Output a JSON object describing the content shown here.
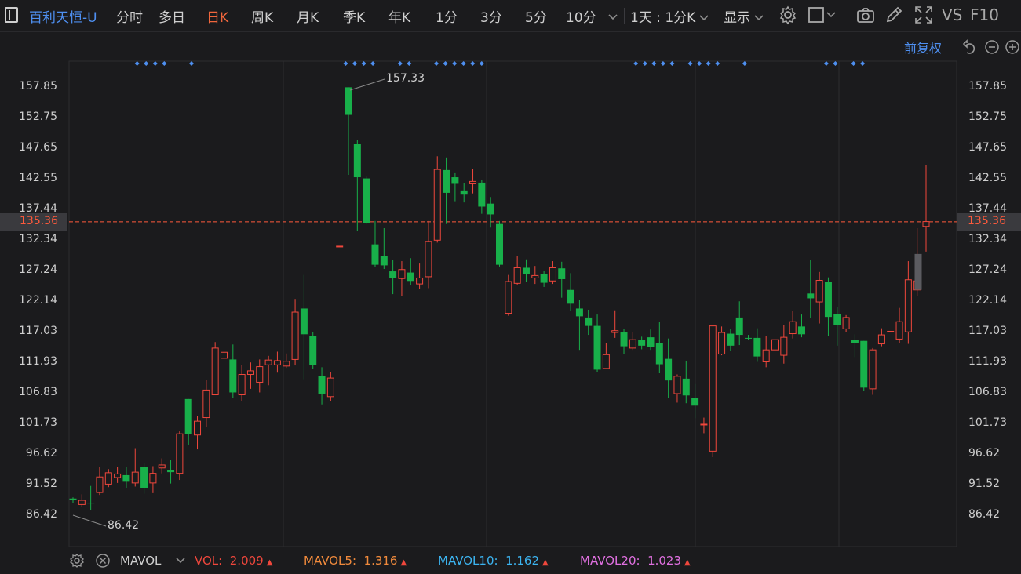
{
  "toolbar": {
    "title": "百利天恒-U",
    "periods": [
      "分时",
      "多日",
      "日K",
      "周K",
      "月K",
      "季K",
      "年K",
      "1分",
      "3分",
      "5分",
      "10分"
    ],
    "active_period": "日K",
    "combo": "1天 : 1分K",
    "display": "显示",
    "vs": "VS",
    "f10": "F10"
  },
  "header_right": {
    "adjust": "前复权"
  },
  "axis": {
    "ticks": [
      "157.85",
      "152.75",
      "147.65",
      "142.55",
      "137.44",
      "132.34",
      "127.24",
      "122.14",
      "117.03",
      "111.93",
      "106.83",
      "101.73",
      "96.62",
      "91.52",
      "86.42"
    ],
    "current_price": "135.36",
    "max_label": "157.33",
    "min_label": "86.42"
  },
  "colors": {
    "up": "#f0473c",
    "down": "#18b04a",
    "dot": "#4e8ff0",
    "bg": "#1b1b1d",
    "current": "#ff5a3c"
  },
  "chart_data": {
    "type": "candlestick",
    "ylim": [
      82,
      160
    ],
    "current_price": 135.36,
    "max": 157.33,
    "min": 86.42,
    "candles": [
      [
        89.2,
        89.0,
        88.5,
        89.4
      ],
      [
        88.2,
        88.9,
        87.8,
        89.9
      ],
      [
        88.5,
        88.4,
        87.3,
        91.3
      ],
      [
        90.2,
        92.8,
        89.8,
        94.5
      ],
      [
        91.6,
        93.5,
        91.1,
        94.1
      ],
      [
        92.7,
        93.3,
        91.8,
        94.5
      ],
      [
        93.1,
        92.0,
        91.0,
        94.4
      ],
      [
        91.8,
        93.6,
        91.2,
        97.6
      ],
      [
        94.5,
        91.0,
        90.0,
        95.1
      ],
      [
        91.8,
        93.4,
        90.1,
        94.6
      ],
      [
        94.3,
        94.8,
        93.4,
        95.9
      ],
      [
        94.0,
        93.6,
        91.7,
        95.7
      ],
      [
        93.4,
        100.0,
        92.3,
        100.4
      ],
      [
        105.8,
        100.0,
        98.2,
        105.8
      ],
      [
        99.8,
        102.1,
        97.4,
        103.0
      ],
      [
        102.7,
        107.3,
        101.2,
        109.0
      ],
      [
        106.5,
        114.3,
        106.5,
        115.3
      ],
      [
        112.6,
        113.6,
        109.9,
        114.3
      ],
      [
        112.4,
        106.9,
        106.0,
        114.9
      ],
      [
        106.5,
        109.9,
        105.5,
        111.5
      ],
      [
        109.9,
        110.5,
        107.5,
        111.9
      ],
      [
        108.6,
        111.2,
        106.9,
        112.4
      ],
      [
        111.5,
        112.3,
        108.1,
        113.0
      ],
      [
        111.5,
        112.2,
        110.2,
        113.7
      ],
      [
        111.3,
        112.1,
        111.0,
        113.4
      ],
      [
        112.4,
        120.3,
        111.4,
        122.5
      ],
      [
        120.9,
        116.6,
        109.1,
        126.5
      ],
      [
        116.3,
        111.5,
        110.8,
        117.0
      ],
      [
        109.6,
        106.7,
        104.9,
        111.1
      ],
      [
        106.2,
        109.3,
        105.5,
        110.3
      ],
      [
        131.3,
        131.3,
        131.3,
        131.3
      ],
      [
        157.8,
        153.2,
        143.2,
        157.8
      ],
      [
        148.3,
        142.8,
        133.9,
        149.0
      ],
      [
        142.6,
        135.2,
        135.0,
        142.9
      ],
      [
        131.6,
        128.2,
        127.9,
        135.5
      ],
      [
        129.7,
        128.1,
        127.5,
        134.3
      ],
      [
        127.1,
        126.0,
        123.3,
        129.0
      ],
      [
        125.9,
        127.4,
        123.0,
        128.8
      ],
      [
        126.9,
        125.5,
        124.8,
        129.3
      ],
      [
        125.0,
        126.0,
        124.2,
        128.4
      ],
      [
        126.2,
        132.1,
        124.3,
        135.5
      ],
      [
        132.3,
        144.1,
        131.9,
        146.3
      ],
      [
        144.0,
        140.2,
        135.0,
        146.1
      ],
      [
        142.8,
        141.7,
        138.8,
        143.6
      ],
      [
        140.6,
        139.9,
        138.6,
        141.8
      ],
      [
        141.7,
        142.1,
        140.1,
        144.2
      ],
      [
        141.9,
        137.9,
        136.7,
        142.4
      ],
      [
        138.4,
        136.6,
        134.4,
        139.5
      ],
      [
        135.0,
        128.2,
        127.9,
        135.5
      ],
      [
        120.1,
        125.4,
        119.7,
        126.5
      ],
      [
        125.1,
        127.7,
        124.9,
        129.6
      ],
      [
        127.7,
        126.7,
        125.3,
        129.1
      ],
      [
        126.0,
        126.4,
        125.0,
        128.0
      ],
      [
        126.6,
        125.2,
        124.5,
        127.2
      ],
      [
        125.5,
        127.7,
        125.0,
        128.8
      ],
      [
        127.6,
        125.8,
        122.7,
        128.7
      ],
      [
        124.0,
        121.7,
        120.5,
        126.8
      ],
      [
        120.9,
        119.6,
        114.0,
        122.3
      ],
      [
        119.4,
        118.0,
        116.5,
        120.7
      ],
      [
        118.0,
        110.7,
        110.3,
        119.9
      ],
      [
        110.9,
        113.2,
        111.9,
        115.1
      ],
      [
        116.9,
        117.2,
        116.0,
        120.6
      ],
      [
        116.9,
        114.6,
        113.3,
        117.5
      ],
      [
        114.3,
        115.7,
        114.0,
        116.9
      ],
      [
        115.7,
        114.7,
        114.1,
        116.2
      ],
      [
        116.1,
        114.5,
        114.0,
        117.4
      ],
      [
        115.1,
        111.6,
        110.1,
        118.6
      ],
      [
        112.5,
        108.9,
        106.0,
        115.9
      ],
      [
        106.7,
        109.6,
        105.2,
        109.9
      ],
      [
        109.2,
        106.4,
        105.1,
        112.2
      ],
      [
        106.0,
        104.7,
        102.6,
        108.3
      ],
      [
        101.6,
        101.6,
        100.1,
        102.7
      ],
      [
        97.1,
        118.0,
        96.1,
        118.0
      ],
      [
        113.3,
        116.9,
        113.1,
        117.9
      ],
      [
        116.7,
        114.7,
        113.8,
        117.5
      ],
      [
        119.4,
        116.5,
        114.8,
        122.1
      ],
      [
        116.0,
        115.9,
        115.6,
        116.5
      ],
      [
        116.0,
        112.9,
        112.0,
        117.6
      ],
      [
        112.0,
        114.0,
        111.1,
        116.3
      ],
      [
        114.0,
        115.7,
        110.7,
        116.8
      ],
      [
        113.1,
        116.1,
        111.7,
        118.1
      ],
      [
        116.7,
        118.7,
        115.9,
        120.5
      ],
      [
        117.9,
        116.6,
        116.1,
        119.9
      ],
      [
        123.4,
        122.6,
        119.3,
        129.0
      ],
      [
        122.0,
        125.6,
        118.4,
        127.0
      ],
      [
        125.4,
        119.5,
        116.3,
        126.1
      ],
      [
        120.0,
        118.2,
        114.7,
        121.2
      ],
      [
        117.5,
        119.4,
        116.9,
        119.8
      ],
      [
        115.6,
        115.1,
        112.8,
        116.6
      ],
      [
        115.5,
        107.7,
        107.2,
        115.5
      ],
      [
        107.5,
        114.0,
        106.5,
        114.3
      ],
      [
        115.0,
        116.5,
        114.6,
        117.6
      ],
      [
        117.1,
        117.1,
        117.1,
        117.1
      ],
      [
        115.8,
        118.7,
        115.1,
        121.0
      ],
      [
        117.0,
        125.7,
        115.0,
        128.8
      ],
      [
        124.0,
        125.5,
        123.0,
        134.3
      ],
      [
        134.6,
        135.4,
        130.4,
        144.9
      ]
    ]
  }
}
